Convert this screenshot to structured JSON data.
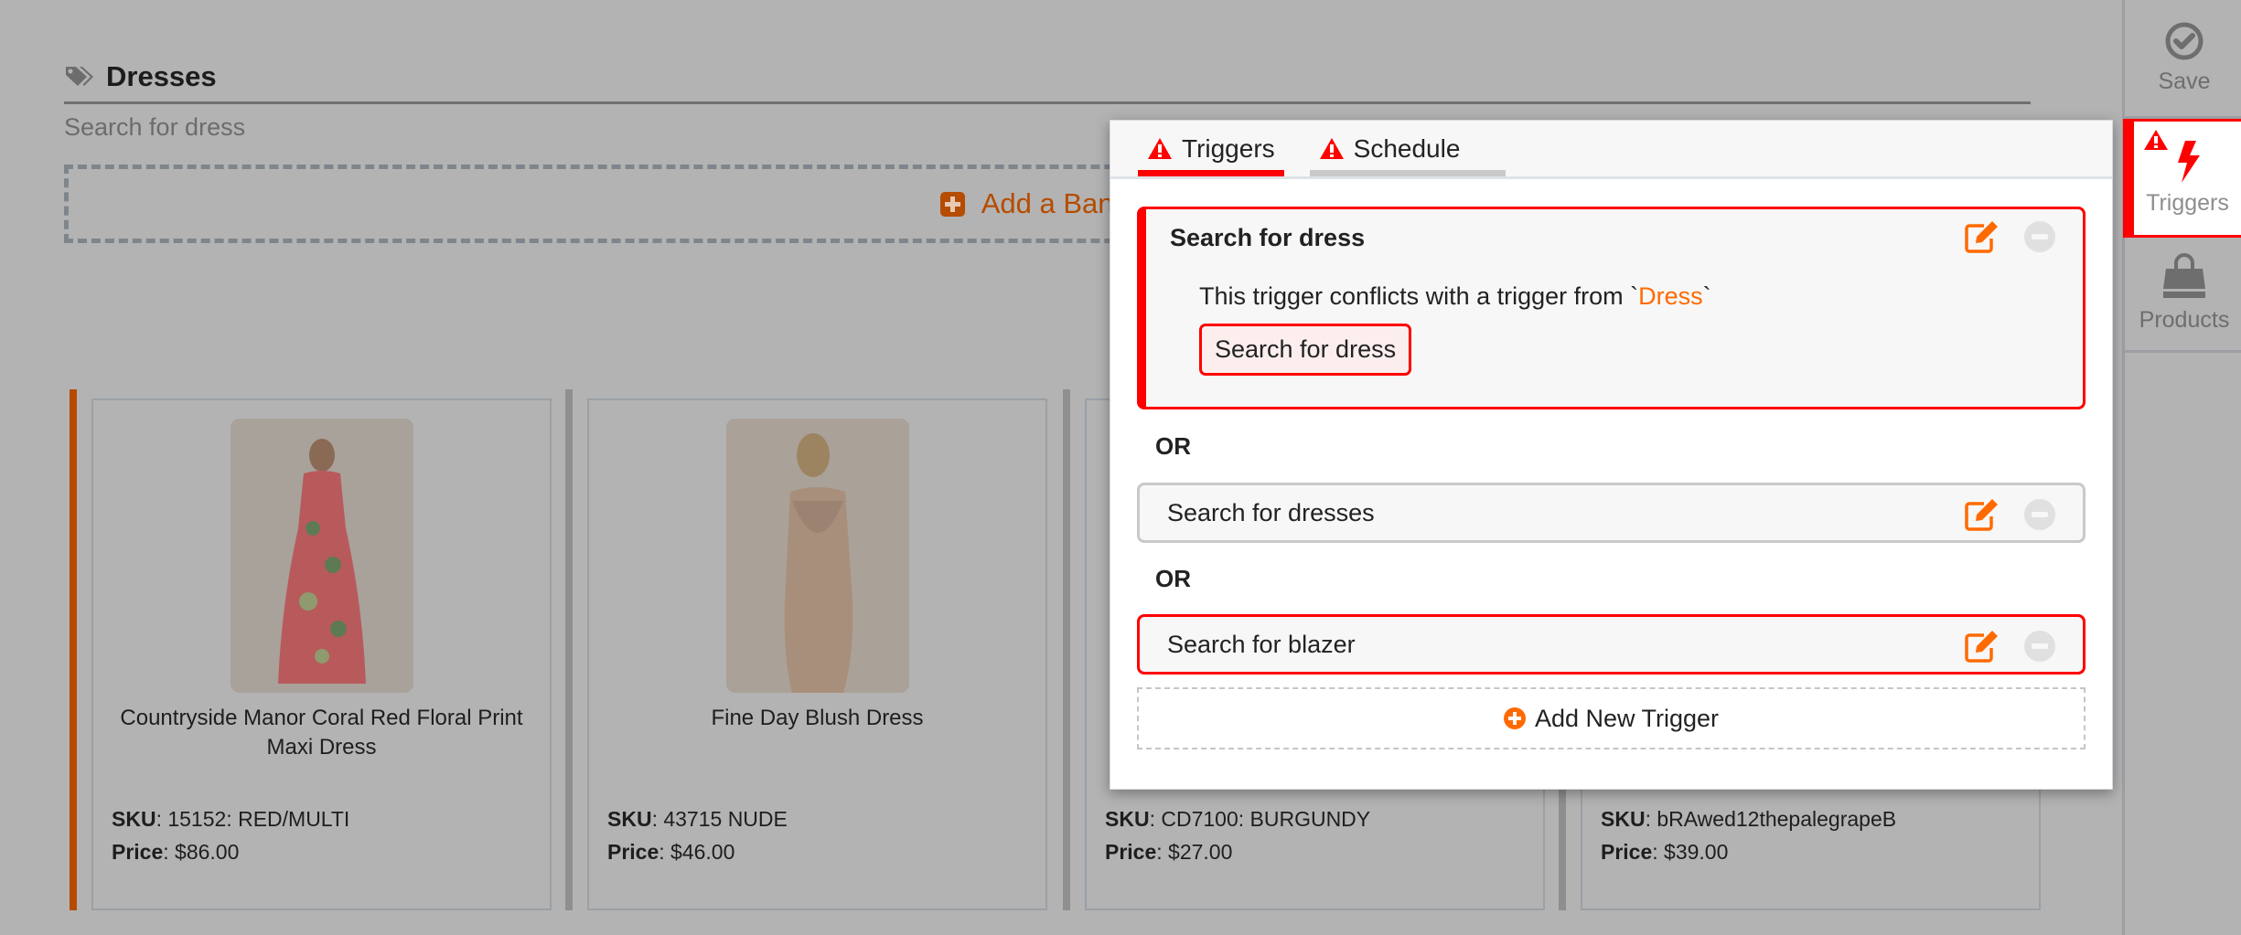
{
  "section": {
    "title": "Dresses",
    "subtitle": "Search for dress",
    "icon": "tags-icon"
  },
  "banner": {
    "label": "Add a Banner",
    "icon": "plus-square-icon"
  },
  "products": [
    {
      "name": "Countryside Manor Coral Red Floral Print Maxi Dress",
      "sku_label": "SKU",
      "sku": "15152: RED/MULTI",
      "price_label": "Price",
      "price": "$86.00",
      "selected": true
    },
    {
      "name": "Fine Day Blush Dress",
      "sku_label": "SKU",
      "sku": "43715 NUDE",
      "price_label": "Price",
      "price": "$46.00",
      "selected": false
    },
    {
      "name": "",
      "sku_label": "SKU",
      "sku": "CD7100: BURGUNDY",
      "price_label": "Price",
      "price": "$27.00",
      "selected": false
    },
    {
      "name": "",
      "sku_label": "SKU",
      "sku": "bRAwed12thepalegrapeB",
      "price_label": "Price",
      "price": "$39.00",
      "selected": false
    }
  ],
  "sidebar": {
    "items": [
      {
        "label": "Save",
        "icon": "check-circle-icon"
      },
      {
        "label": "Triggers",
        "icon": "bolt-icon",
        "active": true,
        "warning": true
      },
      {
        "label": "Products",
        "icon": "shopping-bag-icon"
      }
    ]
  },
  "popup": {
    "tabs": [
      {
        "label": "Triggers",
        "warning": true,
        "active": true
      },
      {
        "label": "Schedule",
        "warning": true,
        "active": false
      }
    ],
    "triggers": [
      {
        "label": "Search for dress",
        "conflict": true,
        "expanded": true,
        "conflict_message": "This trigger conflicts with a trigger from `",
        "conflict_source": "Dress",
        "conflict_message_end": "`",
        "conflict_chip": "Search for dress"
      },
      {
        "label": "Search for dresses",
        "conflict": false
      },
      {
        "label": "Search for blazer",
        "conflict": true
      }
    ],
    "or_label": "OR",
    "add_trigger_label": "Add New Trigger"
  },
  "colors": {
    "accent_orange": "#ff6a00",
    "dim_orange": "#b54c00",
    "error_red": "#ff0000",
    "overlay_gray": "#b3b3b3"
  }
}
